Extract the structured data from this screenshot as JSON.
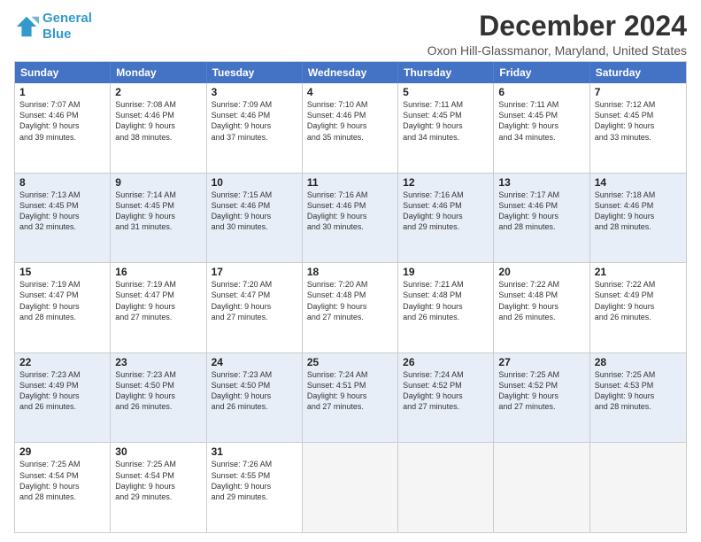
{
  "logo": {
    "line1": "General",
    "line2": "Blue"
  },
  "title": "December 2024",
  "subtitle": "Oxon Hill-Glassmanor, Maryland, United States",
  "header_days": [
    "Sunday",
    "Monday",
    "Tuesday",
    "Wednesday",
    "Thursday",
    "Friday",
    "Saturday"
  ],
  "weeks": [
    [
      {
        "day": "1",
        "sunrise": "7:07 AM",
        "sunset": "4:46 PM",
        "daylight": "9 hours and 39 minutes."
      },
      {
        "day": "2",
        "sunrise": "7:08 AM",
        "sunset": "4:46 PM",
        "daylight": "9 hours and 38 minutes."
      },
      {
        "day": "3",
        "sunrise": "7:09 AM",
        "sunset": "4:46 PM",
        "daylight": "9 hours and 37 minutes."
      },
      {
        "day": "4",
        "sunrise": "7:10 AM",
        "sunset": "4:46 PM",
        "daylight": "9 hours and 35 minutes."
      },
      {
        "day": "5",
        "sunrise": "7:11 AM",
        "sunset": "4:45 PM",
        "daylight": "9 hours and 34 minutes."
      },
      {
        "day": "6",
        "sunrise": "7:11 AM",
        "sunset": "4:45 PM",
        "daylight": "9 hours and 34 minutes."
      },
      {
        "day": "7",
        "sunrise": "7:12 AM",
        "sunset": "4:45 PM",
        "daylight": "9 hours and 33 minutes."
      }
    ],
    [
      {
        "day": "8",
        "sunrise": "7:13 AM",
        "sunset": "4:45 PM",
        "daylight": "9 hours and 32 minutes."
      },
      {
        "day": "9",
        "sunrise": "7:14 AM",
        "sunset": "4:45 PM",
        "daylight": "9 hours and 31 minutes."
      },
      {
        "day": "10",
        "sunrise": "7:15 AM",
        "sunset": "4:46 PM",
        "daylight": "9 hours and 30 minutes."
      },
      {
        "day": "11",
        "sunrise": "7:16 AM",
        "sunset": "4:46 PM",
        "daylight": "9 hours and 30 minutes."
      },
      {
        "day": "12",
        "sunrise": "7:16 AM",
        "sunset": "4:46 PM",
        "daylight": "9 hours and 29 minutes."
      },
      {
        "day": "13",
        "sunrise": "7:17 AM",
        "sunset": "4:46 PM",
        "daylight": "9 hours and 28 minutes."
      },
      {
        "day": "14",
        "sunrise": "7:18 AM",
        "sunset": "4:46 PM",
        "daylight": "9 hours and 28 minutes."
      }
    ],
    [
      {
        "day": "15",
        "sunrise": "7:19 AM",
        "sunset": "4:47 PM",
        "daylight": "9 hours and 28 minutes."
      },
      {
        "day": "16",
        "sunrise": "7:19 AM",
        "sunset": "4:47 PM",
        "daylight": "9 hours and 27 minutes."
      },
      {
        "day": "17",
        "sunrise": "7:20 AM",
        "sunset": "4:47 PM",
        "daylight": "9 hours and 27 minutes."
      },
      {
        "day": "18",
        "sunrise": "7:20 AM",
        "sunset": "4:48 PM",
        "daylight": "9 hours and 27 minutes."
      },
      {
        "day": "19",
        "sunrise": "7:21 AM",
        "sunset": "4:48 PM",
        "daylight": "9 hours and 26 minutes."
      },
      {
        "day": "20",
        "sunrise": "7:22 AM",
        "sunset": "4:48 PM",
        "daylight": "9 hours and 26 minutes."
      },
      {
        "day": "21",
        "sunrise": "7:22 AM",
        "sunset": "4:49 PM",
        "daylight": "9 hours and 26 minutes."
      }
    ],
    [
      {
        "day": "22",
        "sunrise": "7:23 AM",
        "sunset": "4:49 PM",
        "daylight": "9 hours and 26 minutes."
      },
      {
        "day": "23",
        "sunrise": "7:23 AM",
        "sunset": "4:50 PM",
        "daylight": "9 hours and 26 minutes."
      },
      {
        "day": "24",
        "sunrise": "7:23 AM",
        "sunset": "4:50 PM",
        "daylight": "9 hours and 26 minutes."
      },
      {
        "day": "25",
        "sunrise": "7:24 AM",
        "sunset": "4:51 PM",
        "daylight": "9 hours and 27 minutes."
      },
      {
        "day": "26",
        "sunrise": "7:24 AM",
        "sunset": "4:52 PM",
        "daylight": "9 hours and 27 minutes."
      },
      {
        "day": "27",
        "sunrise": "7:25 AM",
        "sunset": "4:52 PM",
        "daylight": "9 hours and 27 minutes."
      },
      {
        "day": "28",
        "sunrise": "7:25 AM",
        "sunset": "4:53 PM",
        "daylight": "9 hours and 28 minutes."
      }
    ],
    [
      {
        "day": "29",
        "sunrise": "7:25 AM",
        "sunset": "4:54 PM",
        "daylight": "9 hours and 28 minutes."
      },
      {
        "day": "30",
        "sunrise": "7:25 AM",
        "sunset": "4:54 PM",
        "daylight": "9 hours and 29 minutes."
      },
      {
        "day": "31",
        "sunrise": "7:26 AM",
        "sunset": "4:55 PM",
        "daylight": "9 hours and 29 minutes."
      },
      null,
      null,
      null,
      null
    ]
  ],
  "colors": {
    "header_bg": "#4472c4",
    "alt_row_bg": "#e8eef7",
    "normal_row_bg": "#ffffff"
  }
}
